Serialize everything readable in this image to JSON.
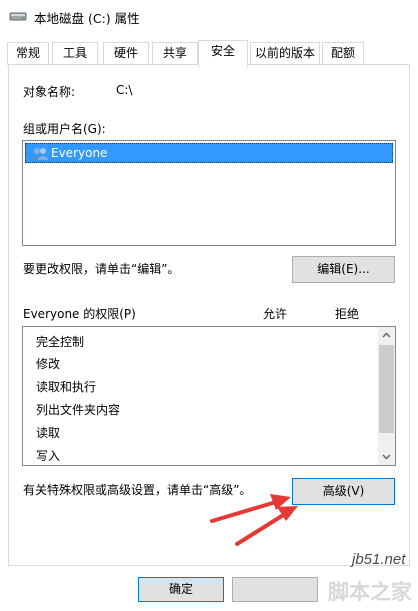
{
  "window": {
    "title": "本地磁盘 (C:) 属性"
  },
  "tabs": [
    {
      "label": "常规",
      "active": false
    },
    {
      "label": "工具",
      "active": false
    },
    {
      "label": "硬件",
      "active": false
    },
    {
      "label": "共享",
      "active": false
    },
    {
      "label": "安全",
      "active": true
    },
    {
      "label": "以前的版本",
      "active": false
    },
    {
      "label": "配额",
      "active": false
    }
  ],
  "security": {
    "object_name_label": "对象名称:",
    "object_name_value": "C:\\",
    "group_label": "组或用户名(G):",
    "groups": [
      "Everyone"
    ],
    "edit_hint": "要更改权限，请单击“编辑”。",
    "edit_button": "编辑(E)...",
    "perm_header": "Everyone 的权限(P)",
    "allow_header": "允许",
    "deny_header": "拒绝",
    "permissions": [
      "完全控制",
      "修改",
      "读取和执行",
      "列出文件夹内容",
      "读取",
      "写入"
    ],
    "advanced_hint": "有关特殊权限或高级设置，请单击“高级”。",
    "advanced_button": "高级(V)"
  },
  "footer": {
    "ok_button": "确定"
  },
  "watermark": {
    "site": "jb51.net",
    "name": "脚本之家"
  },
  "colors": {
    "selection": "#3399ff",
    "annotation_arrow": "#e53935",
    "focus_border": "#0078d7"
  },
  "icons": {
    "title_icon": "drive-icon",
    "group_icon": "users-icon"
  }
}
